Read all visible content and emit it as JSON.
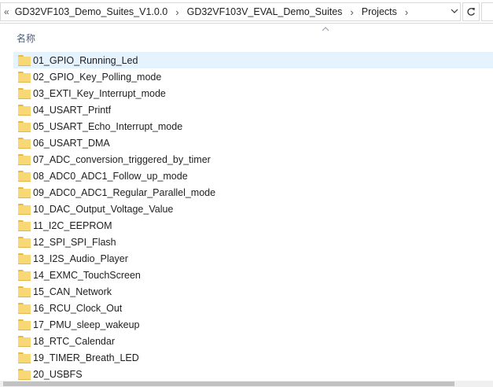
{
  "address_bar": {
    "prefix": "«",
    "crumbs": [
      "GD32VF103_Demo_Suites_V1.0.0",
      "GD32VF103V_EVAL_Demo_Suites",
      "Projects"
    ],
    "separator": "›"
  },
  "header": {
    "name_column": "名称"
  },
  "colors": {
    "selected_row": "#e5f3ff",
    "folder": "#f8d775",
    "header_text": "#4c607a"
  },
  "items": [
    {
      "label": "01_GPIO_Running_Led",
      "selected": true
    },
    {
      "label": "02_GPIO_Key_Polling_mode"
    },
    {
      "label": "03_EXTI_Key_Interrupt_mode"
    },
    {
      "label": "04_USART_Printf"
    },
    {
      "label": "05_USART_Echo_Interrupt_mode"
    },
    {
      "label": "06_USART_DMA"
    },
    {
      "label": "07_ADC_conversion_triggered_by_timer"
    },
    {
      "label": "08_ADC0_ADC1_Follow_up_mode"
    },
    {
      "label": "09_ADC0_ADC1_Regular_Parallel_mode"
    },
    {
      "label": "10_DAC_Output_Voltage_Value"
    },
    {
      "label": "11_I2C_EEPROM"
    },
    {
      "label": "12_SPI_SPI_Flash"
    },
    {
      "label": "13_I2S_Audio_Player"
    },
    {
      "label": "14_EXMC_TouchScreen"
    },
    {
      "label": "15_CAN_Network"
    },
    {
      "label": "16_RCU_Clock_Out"
    },
    {
      "label": "17_PMU_sleep_wakeup"
    },
    {
      "label": "18_RTC_Calendar"
    },
    {
      "label": "19_TIMER_Breath_LED"
    },
    {
      "label": "20_USBFS"
    }
  ]
}
